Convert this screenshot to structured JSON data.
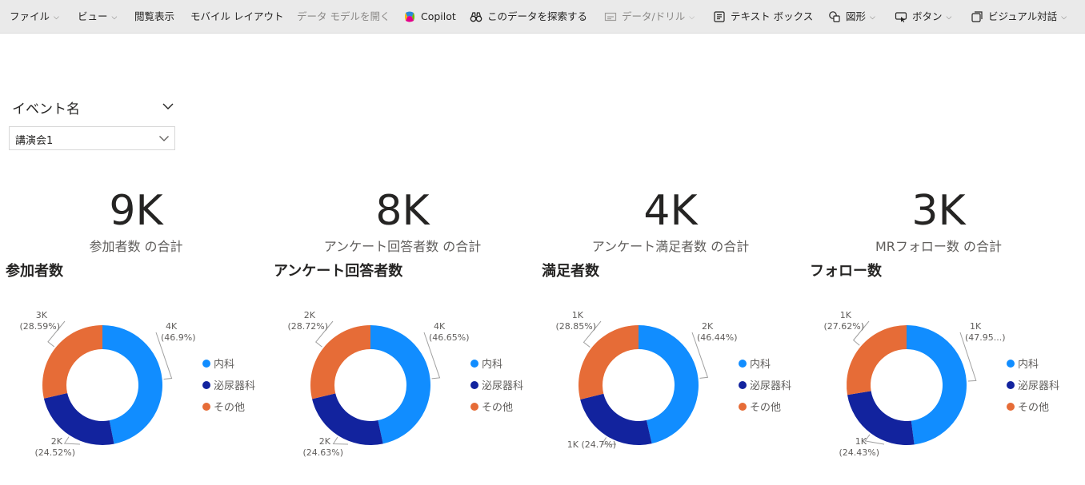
{
  "toolbar": {
    "items": [
      {
        "label": "ファイル",
        "chevron": true,
        "icon": "",
        "disabled": false
      },
      {
        "label": "ビュー",
        "chevron": true,
        "icon": "",
        "disabled": false
      },
      {
        "label": "閲覧表示",
        "chevron": false,
        "icon": "",
        "disabled": false
      },
      {
        "label": "モバイル レイアウト",
        "chevron": false,
        "icon": "",
        "disabled": false
      },
      {
        "label": "データ モデルを開く",
        "chevron": false,
        "icon": "",
        "disabled": true
      },
      {
        "label": "Copilot",
        "chevron": false,
        "icon": "copilot-icon",
        "disabled": false
      },
      {
        "label": "このデータを探索する",
        "chevron": false,
        "icon": "binoculars-icon",
        "disabled": false
      },
      {
        "label": "データ/ドリル",
        "chevron": true,
        "icon": "drill-icon",
        "disabled": true
      },
      {
        "label": "テキスト ボックス",
        "chevron": false,
        "icon": "textbox-icon",
        "disabled": false
      },
      {
        "label": "図形",
        "chevron": true,
        "icon": "shapes-icon",
        "disabled": false
      },
      {
        "label": "ボタン",
        "chevron": true,
        "icon": "button-icon",
        "disabled": false
      },
      {
        "label": "ビジュアル対話",
        "chevron": true,
        "icon": "visual-interaction-icon",
        "disabled": false
      }
    ]
  },
  "slicer": {
    "title": "イベント名",
    "selected": "講演会1"
  },
  "cards": [
    {
      "value": "9K",
      "label": "参加者数 の合計"
    },
    {
      "value": "8K",
      "label": "アンケート回答者数 の合計"
    },
    {
      "value": "4K",
      "label": "アンケート満足者数 の合計"
    },
    {
      "value": "3K",
      "label": "MRフォロー数 の合計"
    }
  ],
  "colors": {
    "内科": "#118dff",
    "泌尿器科": "#12239e",
    "その他": "#e66c37"
  },
  "chart_data": [
    {
      "type": "pie",
      "title": "参加者数",
      "categories": [
        "内科",
        "泌尿器科",
        "その他"
      ],
      "values": [
        46.9,
        24.52,
        28.59
      ],
      "labels": [
        {
          "value": "4K",
          "pct": "(46.9%)"
        },
        {
          "value": "2K",
          "pct": "(24.52%)"
        },
        {
          "value": "3K",
          "pct": "(28.59%)"
        }
      ],
      "legend": "right"
    },
    {
      "type": "pie",
      "title": "アンケート回答者数",
      "categories": [
        "内科",
        "泌尿器科",
        "その他"
      ],
      "values": [
        46.65,
        24.63,
        28.72
      ],
      "labels": [
        {
          "value": "4K",
          "pct": "(46.65%)"
        },
        {
          "value": "2K",
          "pct": "(24.63%)"
        },
        {
          "value": "2K",
          "pct": "(28.72%)"
        }
      ],
      "legend": "right"
    },
    {
      "type": "pie",
      "title": "満足者数",
      "categories": [
        "内科",
        "泌尿器科",
        "その他"
      ],
      "values": [
        46.44,
        24.7,
        28.85
      ],
      "labels": [
        {
          "value": "2K",
          "pct": "(46.44%)"
        },
        {
          "value": "1K (24.7%)",
          "pct": ""
        },
        {
          "value": "1K",
          "pct": "(28.85%)"
        }
      ],
      "legend": "right"
    },
    {
      "type": "pie",
      "title": "フォロー数",
      "categories": [
        "内科",
        "泌尿器科",
        "その他"
      ],
      "values": [
        47.95,
        24.43,
        27.62
      ],
      "labels": [
        {
          "value": "1K",
          "pct": "(47.95...)"
        },
        {
          "value": "1K",
          "pct": "(24.43%)"
        },
        {
          "value": "1K",
          "pct": "(27.62%)"
        }
      ],
      "legend": "right"
    }
  ]
}
